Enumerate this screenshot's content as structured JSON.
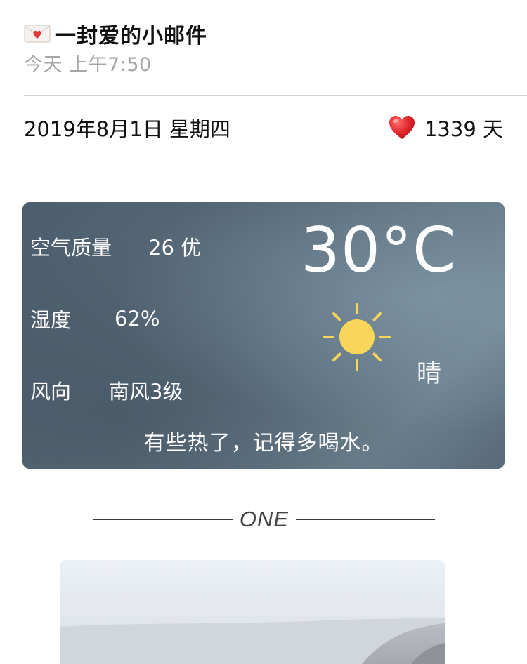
{
  "header": {
    "icon": "envelope-heart-icon",
    "title": "一封爱的小邮件",
    "time": "今天 上午7:50"
  },
  "date_row": {
    "date": "2019年8月1日 星期四",
    "icon": "heart-icon",
    "days": "1339 天"
  },
  "weather": {
    "air_quality_label": "空气质量",
    "air_quality_value": "26 优",
    "humidity_label": "湿度",
    "humidity_value": "62%",
    "wind_label": "风向",
    "wind_value": "南风3级",
    "temperature": "30°C",
    "condition_icon": "sun-icon",
    "condition": "晴",
    "tip": "有些热了，记得多喝水。",
    "colors": {
      "card": "#5a6c7b",
      "sun": "#f9d65a"
    }
  },
  "section": {
    "label": "ONE"
  }
}
